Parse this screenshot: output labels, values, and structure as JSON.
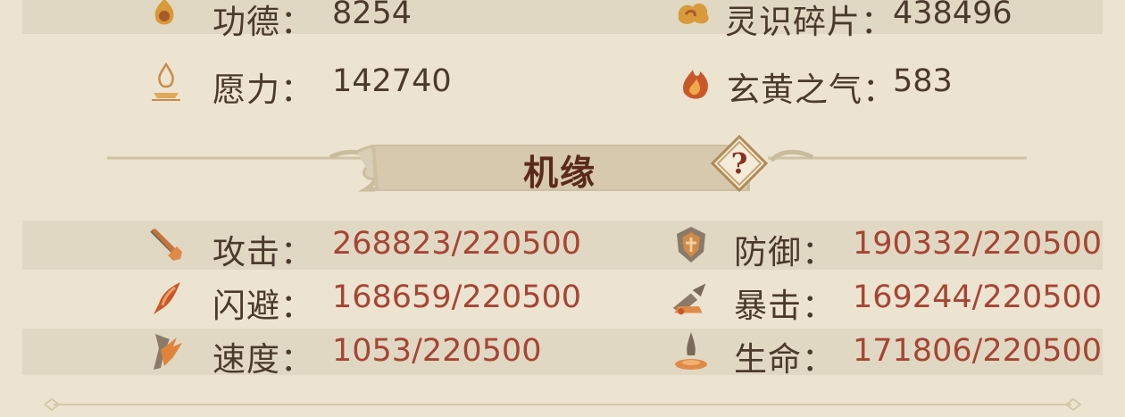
{
  "resources": {
    "gongde": {
      "label": "功德：",
      "value": "8254"
    },
    "lingshi": {
      "label": "灵识碎片：",
      "value": "438496"
    },
    "yuanli": {
      "label": "愿力：",
      "value": "142740"
    },
    "xuanhuang": {
      "label": "玄黄之气：",
      "value": "583"
    }
  },
  "section": {
    "title": "机缘",
    "help_symbol": "?"
  },
  "stats": {
    "attack": {
      "label": "攻击：",
      "value": "268823/220500"
    },
    "defense": {
      "label": "防御：",
      "value": "190332/220500"
    },
    "dodge": {
      "label": "闪避：",
      "value": "168659/220500"
    },
    "crit": {
      "label": "暴击：",
      "value": "169244/220500"
    },
    "speed": {
      "label": "速度：",
      "value": "1053/220500"
    },
    "hp": {
      "label": "生命：",
      "value": "171806/220500"
    }
  },
  "icons": {
    "gongde": "lotus-flame-icon",
    "lingshi": "cloud-swirl-icon",
    "yuanli": "incense-fire-icon",
    "xuanhuang": "flame-cloud-icon",
    "attack": "sword-icon",
    "defense": "shield-icon",
    "dodge": "swift-figure-icon",
    "crit": "cannon-icon",
    "speed": "running-figure-icon",
    "hp": "water-drop-icon"
  },
  "colors": {
    "background": "#ece4d0",
    "stripe": "#e0d8c3",
    "value_red": "#a64535",
    "text": "#4a3a2c",
    "accent": "#c9954a"
  }
}
